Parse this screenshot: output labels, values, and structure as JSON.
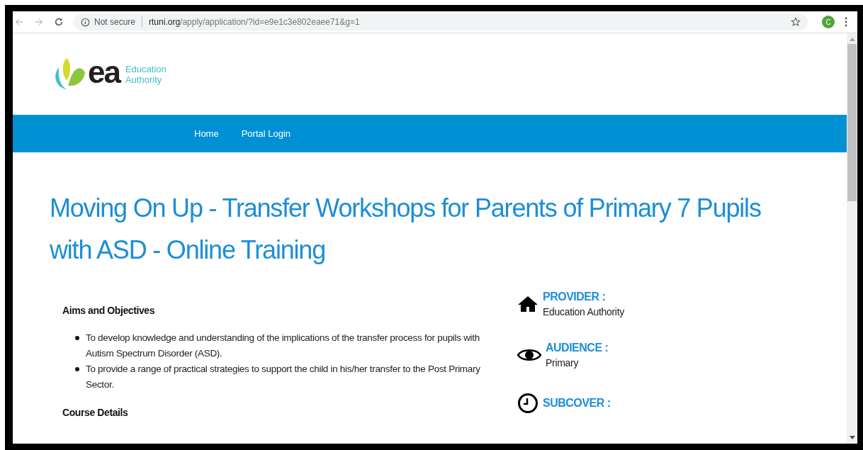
{
  "browser": {
    "address": {
      "security": "Not secure",
      "domain": "rtuni.org",
      "path": "/apply/application/?id=e9e1c3e802eaee71&g=1"
    },
    "profile": {
      "initial": "C"
    }
  },
  "logo": {
    "wordmark": "ea",
    "line1": "Education",
    "line2": "Authority"
  },
  "nav": [
    {
      "label": "Home"
    },
    {
      "label": "Portal Login"
    }
  ],
  "title": "Moving On Up - Transfer Workshops for Parents of Primary 7 Pupils with ASD - Online Training",
  "sections": [
    {
      "heading": "Aims and Objectives",
      "bullets": [
        "To develop knowledge and understanding of the implications of the transfer process for pupils with Autism Spectrum Disorder (ASD).",
        "To provide a range of practical strategies to support the child in his/her transfer to the Post Primary Sector."
      ]
    },
    {
      "heading": "Course Details"
    }
  ],
  "details": [
    {
      "kind": "house",
      "label": "PROVIDER :",
      "value": "Education Authority"
    },
    {
      "kind": "eye",
      "label": "AUDIENCE :",
      "value": "Primary"
    },
    {
      "kind": "clock",
      "label": "SUBCOVER :"
    }
  ]
}
